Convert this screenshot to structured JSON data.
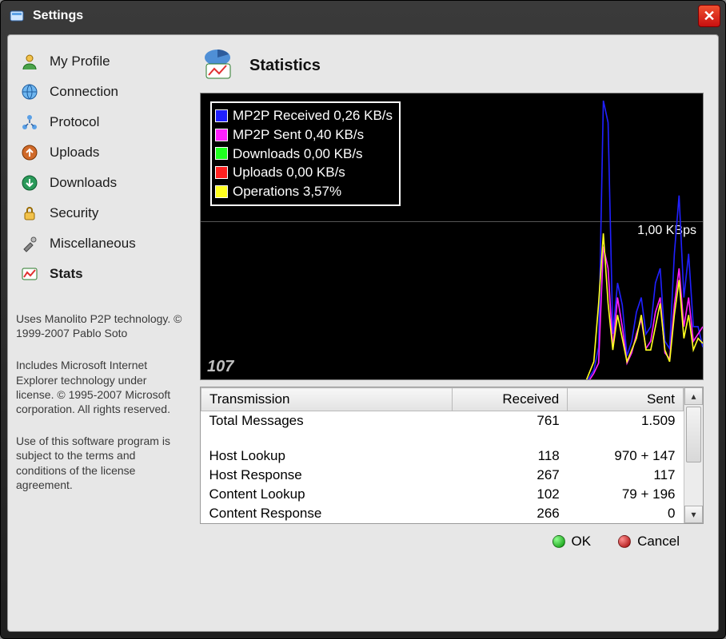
{
  "window": {
    "title": "Settings"
  },
  "sidebar": {
    "items": [
      {
        "label": "My Profile",
        "icon": "person-icon"
      },
      {
        "label": "Connection",
        "icon": "globe-icon"
      },
      {
        "label": "Protocol",
        "icon": "network-icon"
      },
      {
        "label": "Uploads",
        "icon": "upload-icon"
      },
      {
        "label": "Downloads",
        "icon": "download-icon"
      },
      {
        "label": "Security",
        "icon": "lock-icon"
      },
      {
        "label": "Miscellaneous",
        "icon": "tools-icon"
      },
      {
        "label": "Stats",
        "icon": "stats-icon",
        "selected": true
      }
    ],
    "notes": [
      "Uses Manolito P2P technology. © 1999-2007 Pablo Soto",
      "Includes Microsoft Internet Explorer technology under license. © 1995-2007 Microsoft corporation. All rights reserved.",
      "Use of this software program is subject to the terms and conditions of the license agreement."
    ]
  },
  "page": {
    "title": "Statistics"
  },
  "graph": {
    "legend": [
      {
        "color": "#2020ff",
        "label": "MP2P Received",
        "value": "0,26 KB/s"
      },
      {
        "color": "#ff20ff",
        "label": "MP2P Sent",
        "value": "0,40 KB/s"
      },
      {
        "color": "#20ff20",
        "label": "Downloads",
        "value": "0,00 KB/s"
      },
      {
        "color": "#ff2020",
        "label": "Uploads",
        "value": "0,00 KB/s"
      },
      {
        "color": "#ffff20",
        "label": "Operations",
        "value": "3,57%"
      }
    ],
    "ylabel": "1,00 KBps",
    "counter": "107"
  },
  "chart_data": {
    "type": "line",
    "title": "Statistics",
    "ylabel": "KBps",
    "ylim": [
      0,
      2
    ],
    "grid_y": [
      1.0
    ],
    "x_count": 107,
    "series": [
      {
        "name": "MP2P Received",
        "color": "#2020ff",
        "values": [
          0,
          0,
          0,
          0,
          0,
          0,
          0,
          0,
          0,
          0,
          0,
          0,
          0,
          0,
          0,
          0,
          0,
          0,
          0,
          0,
          0,
          0,
          0,
          0,
          0,
          0,
          0,
          0,
          0,
          0,
          0,
          0,
          0,
          0,
          0,
          0,
          0,
          0,
          0,
          0,
          0,
          0,
          0,
          0,
          0,
          0,
          0,
          0,
          0,
          0,
          0,
          0,
          0,
          0,
          0,
          0,
          0,
          0,
          0,
          0,
          0,
          0,
          0,
          0,
          0,
          0,
          0,
          0,
          0,
          0,
          0,
          0,
          0,
          0,
          0,
          0,
          0,
          0,
          0,
          0,
          0,
          0,
          0.05,
          0.1,
          0.26,
          1.95,
          1.8,
          0.35,
          0.7,
          0.55,
          0.2,
          0.3,
          0.5,
          0.6,
          0.35,
          0.4,
          0.7,
          0.8,
          0.3,
          0.25,
          0.9,
          1.3,
          0.6,
          0.9,
          0.4,
          0.4,
          0.26
        ]
      },
      {
        "name": "MP2P Sent",
        "color": "#ff20ff",
        "values": [
          0,
          0,
          0,
          0,
          0,
          0,
          0,
          0,
          0,
          0,
          0,
          0,
          0,
          0,
          0,
          0,
          0,
          0,
          0,
          0,
          0,
          0,
          0,
          0,
          0,
          0,
          0,
          0,
          0,
          0,
          0,
          0,
          0,
          0,
          0,
          0,
          0,
          0,
          0,
          0,
          0,
          0,
          0,
          0,
          0,
          0,
          0,
          0,
          0,
          0,
          0,
          0,
          0,
          0,
          0,
          0,
          0,
          0,
          0,
          0,
          0,
          0,
          0,
          0,
          0,
          0,
          0,
          0,
          0,
          0,
          0,
          0,
          0,
          0,
          0,
          0,
          0,
          0,
          0,
          0,
          0,
          0,
          0.03,
          0.08,
          0.15,
          0.95,
          0.8,
          0.25,
          0.6,
          0.4,
          0.15,
          0.22,
          0.35,
          0.45,
          0.25,
          0.3,
          0.5,
          0.6,
          0.22,
          0.18,
          0.55,
          0.8,
          0.4,
          0.6,
          0.3,
          0.35,
          0.4
        ]
      },
      {
        "name": "Downloads",
        "color": "#20ff20",
        "values": [
          0,
          0,
          0,
          0,
          0,
          0,
          0,
          0,
          0,
          0,
          0,
          0,
          0,
          0,
          0,
          0,
          0,
          0,
          0,
          0,
          0,
          0,
          0,
          0,
          0,
          0,
          0,
          0,
          0,
          0,
          0,
          0,
          0,
          0,
          0,
          0,
          0,
          0,
          0,
          0,
          0,
          0,
          0,
          0,
          0,
          0,
          0,
          0,
          0,
          0,
          0,
          0,
          0,
          0,
          0,
          0,
          0,
          0,
          0,
          0,
          0,
          0,
          0,
          0,
          0,
          0,
          0,
          0,
          0,
          0,
          0,
          0,
          0,
          0,
          0,
          0,
          0,
          0,
          0,
          0,
          0,
          0,
          0,
          0,
          0,
          0,
          0,
          0,
          0,
          0,
          0,
          0,
          0,
          0,
          0,
          0,
          0,
          0,
          0,
          0,
          0,
          0,
          0,
          0,
          0,
          0,
          0
        ]
      },
      {
        "name": "Uploads",
        "color": "#ff2020",
        "values": [
          0,
          0,
          0,
          0,
          0,
          0,
          0,
          0,
          0,
          0,
          0,
          0,
          0,
          0,
          0,
          0,
          0,
          0,
          0,
          0,
          0,
          0,
          0,
          0,
          0,
          0,
          0,
          0,
          0,
          0,
          0,
          0,
          0,
          0,
          0,
          0,
          0,
          0,
          0,
          0,
          0,
          0,
          0,
          0,
          0,
          0,
          0,
          0,
          0,
          0,
          0,
          0,
          0,
          0,
          0,
          0,
          0,
          0,
          0,
          0,
          0,
          0,
          0,
          0,
          0,
          0,
          0,
          0,
          0,
          0,
          0,
          0,
          0,
          0,
          0,
          0,
          0,
          0,
          0,
          0,
          0,
          0,
          0,
          0,
          0,
          0,
          0,
          0,
          0,
          0,
          0,
          0,
          0,
          0,
          0,
          0,
          0,
          0,
          0,
          0,
          0,
          0,
          0,
          0,
          0,
          0,
          0
        ]
      },
      {
        "name": "Operations",
        "color": "#ffff20",
        "unit": "%",
        "values": [
          0,
          0,
          0,
          0,
          0,
          0,
          0,
          0,
          0,
          0,
          0,
          0,
          0,
          0,
          0,
          0,
          0,
          0,
          0,
          0,
          0,
          0,
          0,
          0,
          0,
          0,
          0,
          0,
          0,
          0,
          0,
          0,
          0,
          0,
          0,
          0,
          0,
          0,
          0,
          0,
          0,
          0,
          0,
          0,
          0,
          0,
          0,
          0,
          0,
          0,
          0,
          0,
          0,
          0,
          0,
          0,
          0,
          0,
          0,
          0,
          0,
          0,
          0,
          0,
          0,
          0,
          0,
          0,
          0,
          0,
          0,
          0,
          0,
          0,
          0,
          0,
          0,
          0,
          0,
          0,
          0,
          0,
          1,
          2,
          7,
          13,
          7,
          3,
          6,
          4,
          2,
          3,
          4,
          6,
          3,
          3,
          5,
          7,
          3,
          2,
          6,
          9,
          4,
          6,
          3,
          4,
          3.57
        ]
      }
    ]
  },
  "table": {
    "headers": [
      "Transmission",
      "Received",
      "Sent"
    ],
    "rows": [
      {
        "name": "Total Messages",
        "received": "761",
        "sent": "1.509"
      },
      {
        "blank": true
      },
      {
        "name": "Host Lookup",
        "received": "118",
        "sent": "970 + 147"
      },
      {
        "name": "Host Response",
        "received": "267",
        "sent": "117"
      },
      {
        "name": "Content Lookup",
        "received": "102",
        "sent": "79 + 196"
      },
      {
        "name": "Content Response",
        "received": "266",
        "sent": "0"
      }
    ]
  },
  "buttons": {
    "ok": "OK",
    "cancel": "Cancel"
  }
}
